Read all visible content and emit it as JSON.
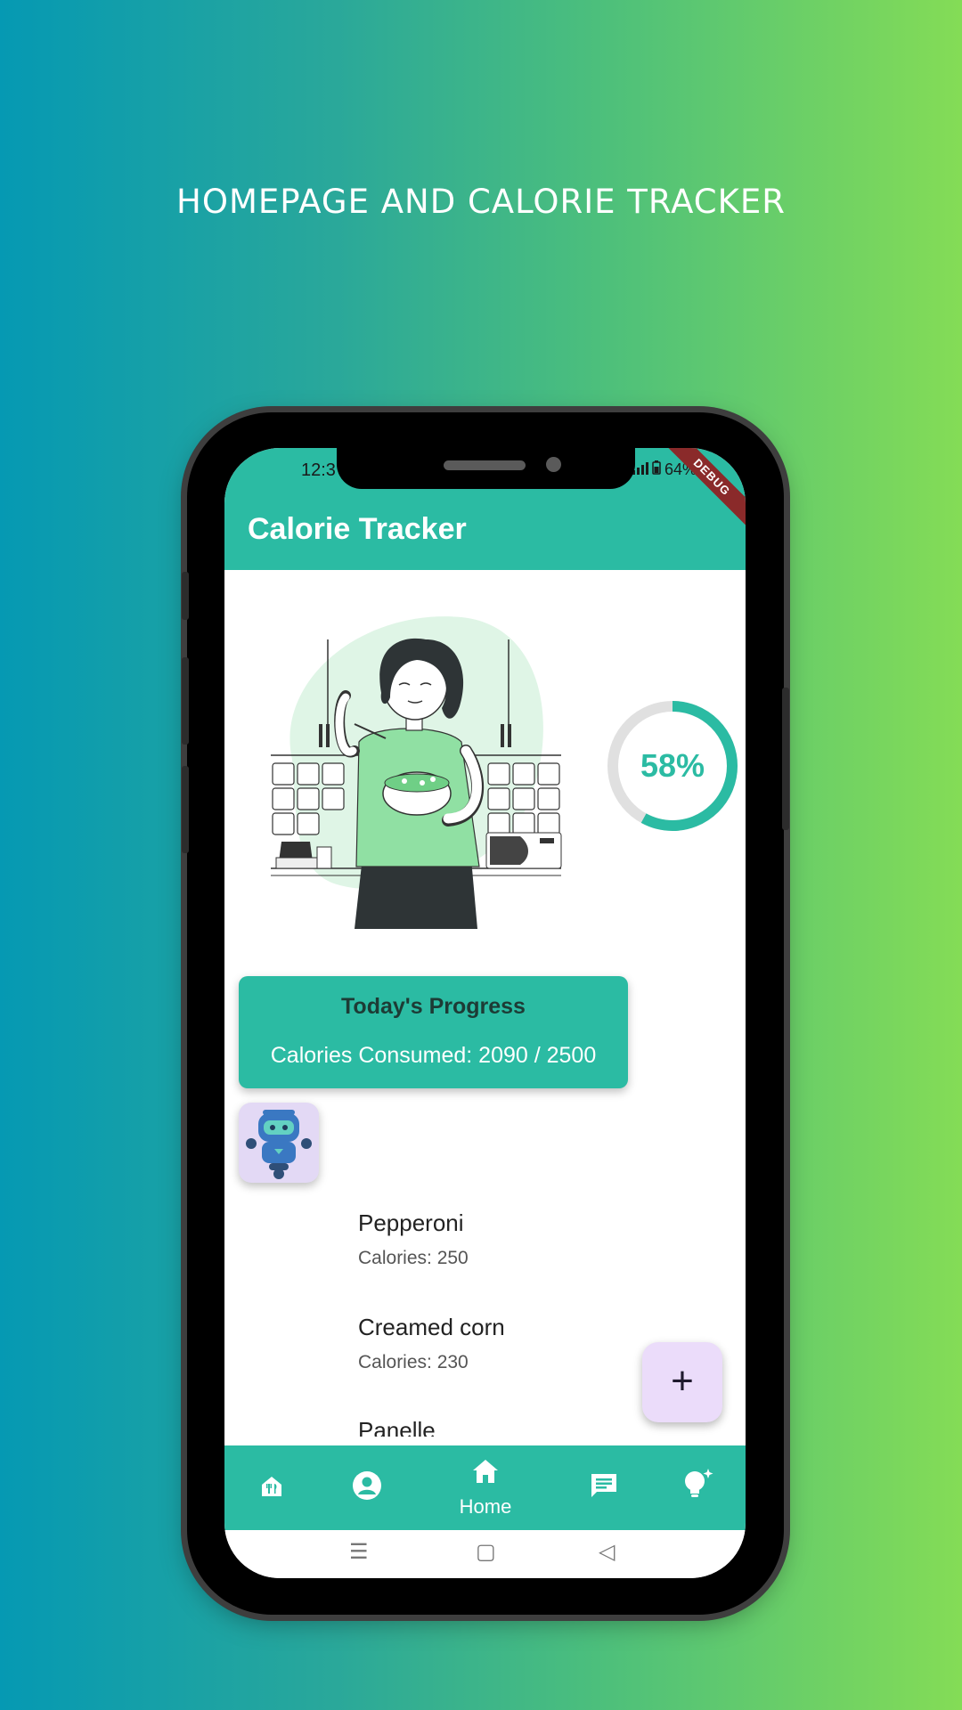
{
  "promo": {
    "title": "HOMEPAGE AND CALORIE TRACKER"
  },
  "status_bar": {
    "time": "12:3",
    "battery": "64%"
  },
  "debug_banner": "DEBUG",
  "app_bar": {
    "title": "Calorie Tracker"
  },
  "progress_ring": {
    "percent_label": "58%",
    "fraction": 0.58
  },
  "progress_card": {
    "title": "Today's Progress",
    "calories_text": "Calories Consumed: 2090 / 2500"
  },
  "food_list": [
    {
      "name": "Pepperoni",
      "calories": "Calories: 250"
    },
    {
      "name": "Creamed corn",
      "calories": "Calories: 230"
    },
    {
      "name": "Panelle",
      "calories": ""
    }
  ],
  "fab": {
    "label": "+"
  },
  "bottom_nav": {
    "items": [
      {
        "icon": "restaurant-icon",
        "label": ""
      },
      {
        "icon": "profile-icon",
        "label": ""
      },
      {
        "icon": "home-icon",
        "label": "Home"
      },
      {
        "icon": "chat-icon",
        "label": ""
      },
      {
        "icon": "lightbulb-icon",
        "label": ""
      }
    ]
  },
  "system_nav": {
    "menu": "☰",
    "home": "▢",
    "back": "◁"
  },
  "colors": {
    "accent": "#2bbba3",
    "fab_bg": "#ebdcfa",
    "ring_track": "#e0e0e0"
  }
}
